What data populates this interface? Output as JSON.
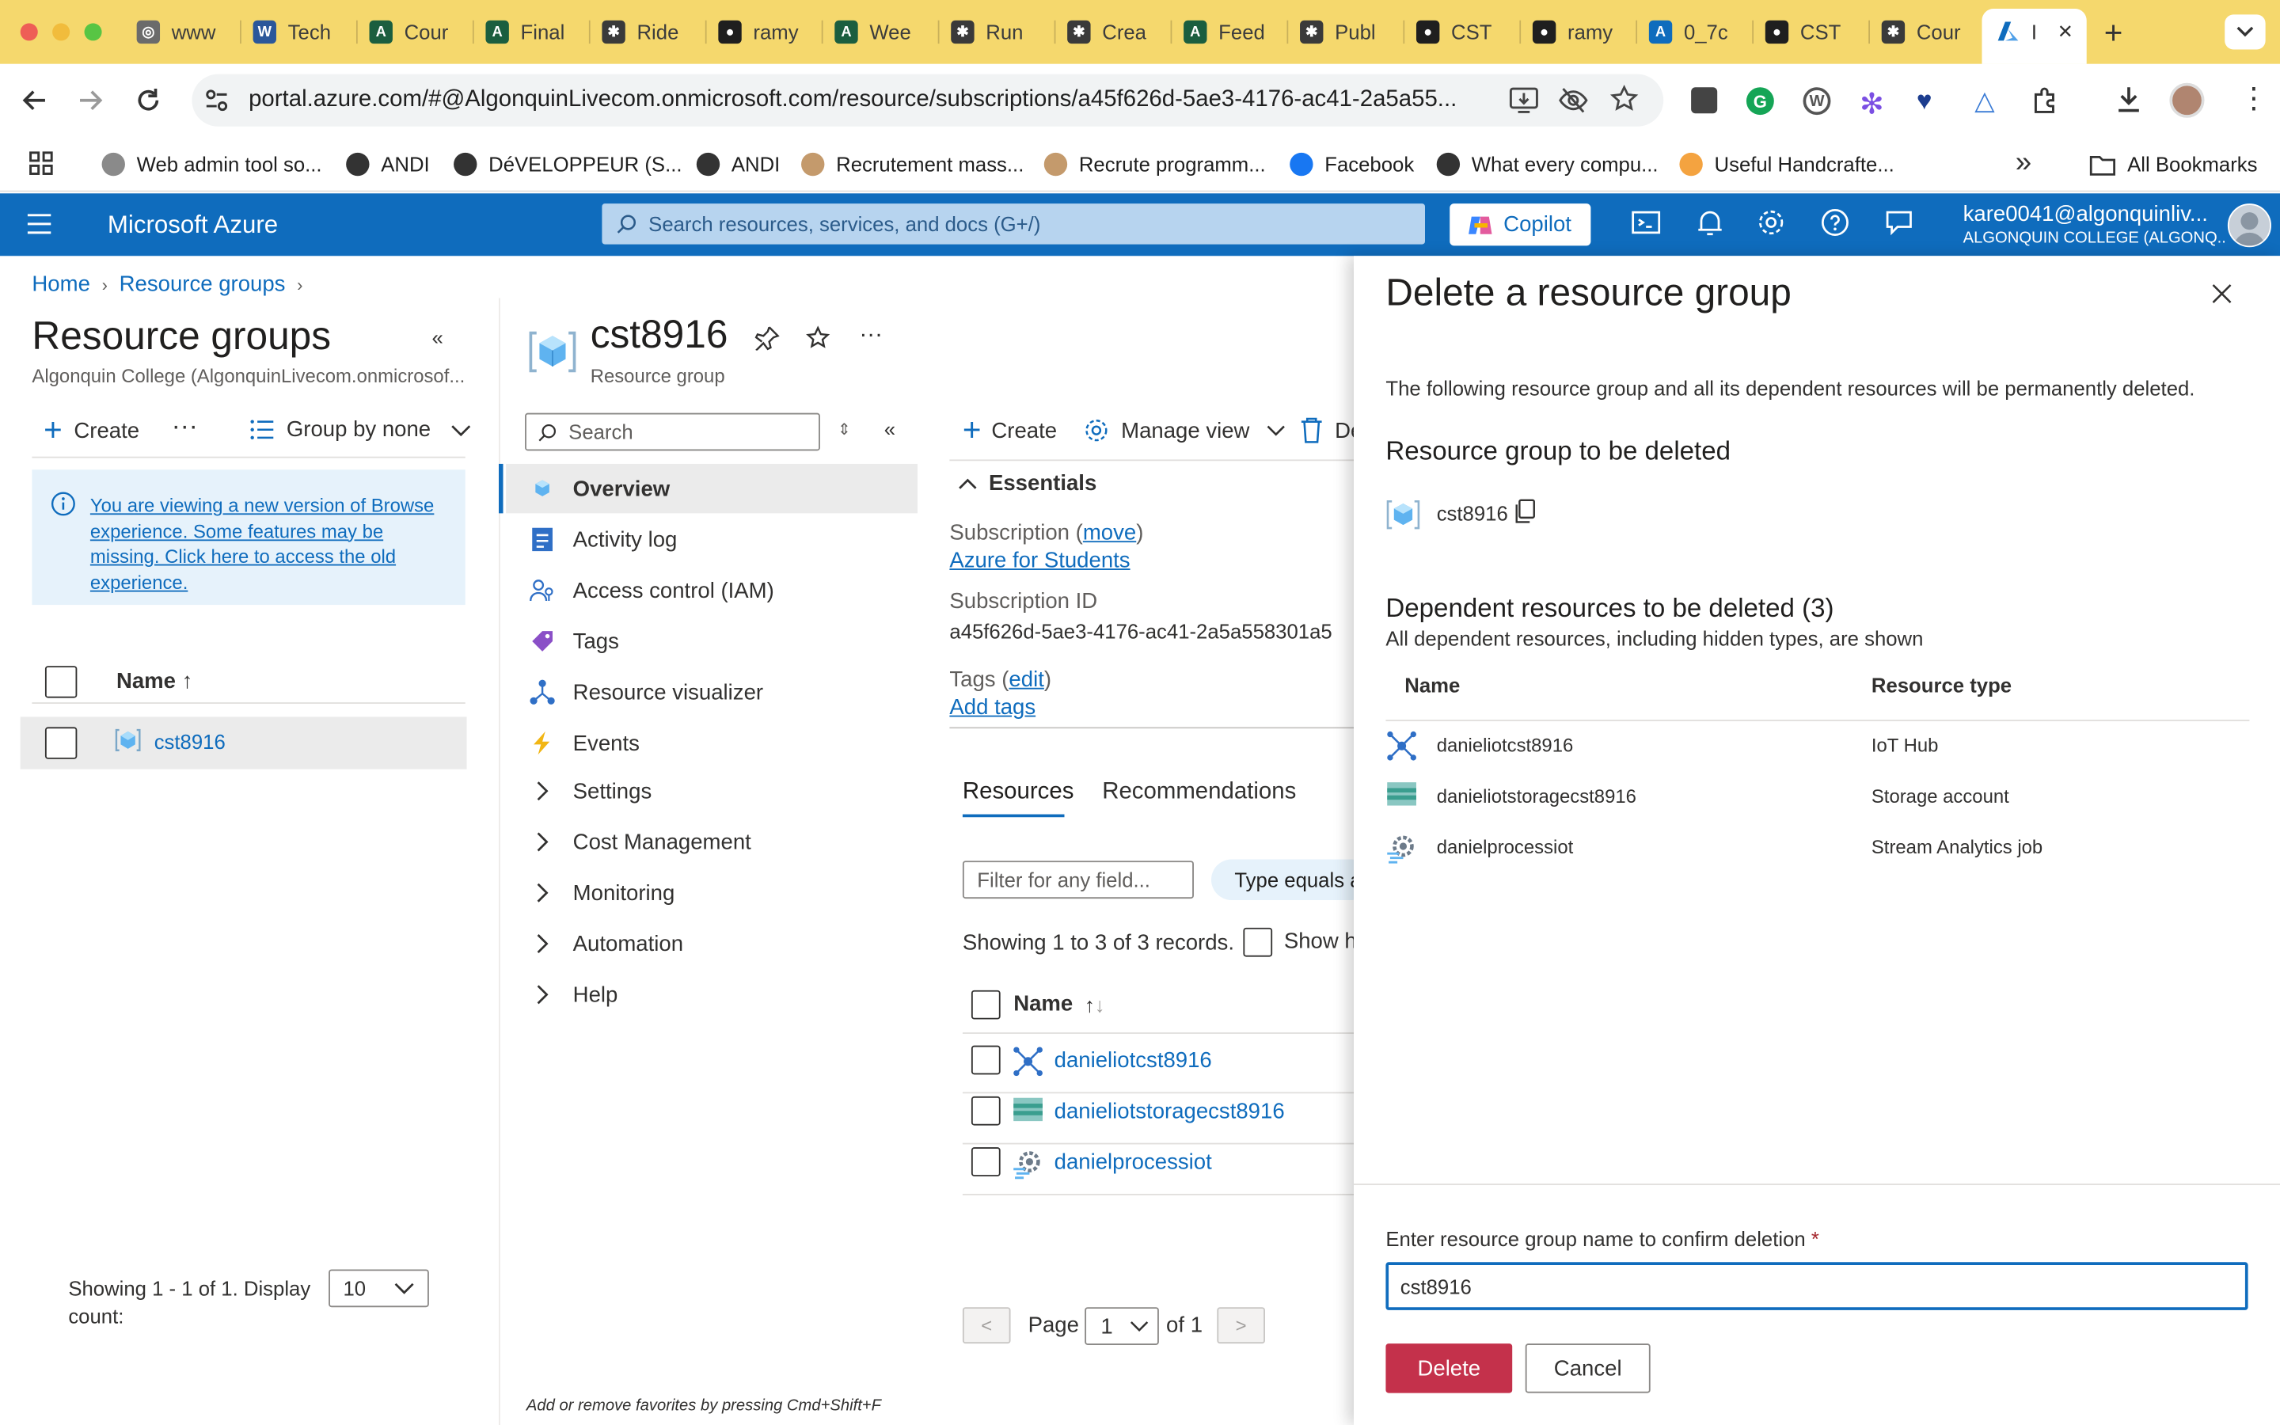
{
  "browser": {
    "tabs": [
      {
        "label": "www",
        "icon": "globe-icon"
      },
      {
        "label": "Tech",
        "icon": "word-icon"
      },
      {
        "label": "Cour",
        "icon": "brightspace-icon"
      },
      {
        "label": "Final",
        "icon": "brightspace-icon"
      },
      {
        "label": "Ride",
        "icon": "chatgpt-icon"
      },
      {
        "label": "ramy",
        "icon": "github-icon"
      },
      {
        "label": "Wee",
        "icon": "brightspace-icon"
      },
      {
        "label": "Run",
        "icon": "chatgpt-icon"
      },
      {
        "label": "Crea",
        "icon": "chatgpt-icon"
      },
      {
        "label": "Feed",
        "icon": "brightspace-icon"
      },
      {
        "label": "Publ",
        "icon": "chatgpt-icon"
      },
      {
        "label": "CST",
        "icon": "github-icon"
      },
      {
        "label": "ramy",
        "icon": "github-icon"
      },
      {
        "label": "0_7c",
        "icon": "azure-icon"
      },
      {
        "label": "CST",
        "icon": "github-icon"
      },
      {
        "label": "Cour",
        "icon": "chatgpt-icon"
      }
    ],
    "active_tab_label": "I",
    "url": "portal.azure.com/#@AlgonquinLivecom.onmicrosoft.com/resource/subscriptions/a45f626d-5ae3-4176-ac41-2a5a55...",
    "bookmarks": [
      {
        "label": "Web admin tool so...",
        "color": "#8a8a8a"
      },
      {
        "label": "ANDI",
        "color": "#333333"
      },
      {
        "label": "DéVELOPPEUR (S...",
        "color": "#333333"
      },
      {
        "label": "ANDI",
        "color": "#333333"
      },
      {
        "label": "Recrutement mass...",
        "color": "#c49a6c"
      },
      {
        "label": "Recrute programm...",
        "color": "#c49a6c"
      },
      {
        "label": "Facebook",
        "color": "#1877f2"
      },
      {
        "label": "What every compu...",
        "color": "#333333"
      },
      {
        "label": "Useful Handcrafte...",
        "color": "#f4a340"
      }
    ],
    "all_bookmarks": "All Bookmarks",
    "overflow": "»"
  },
  "azure": {
    "brand": "Microsoft Azure",
    "search_placeholder": "Search resources, services, and docs (G+/)",
    "copilot": "Copilot",
    "user_email": "kare0041@algonquinliv...",
    "user_org": "ALGONQUIN COLLEGE (ALGONQ..."
  },
  "breadcrumb": {
    "home": "Home",
    "rg": "Resource groups"
  },
  "left": {
    "title": "Resource groups",
    "subtitle": "Algonquin College (AlgonquinLivecom.onmicrosof...",
    "create": "Create",
    "more": "···",
    "group_by": "Group by none",
    "info_text": "You are viewing a new version of Browse experience. Some features may be missing. Click here to access the old experience.",
    "col_name": "Name ↑",
    "rows": [
      "cst8916"
    ],
    "showing": "Showing 1 - 1 of 1. Display count:",
    "display_count": "10"
  },
  "middle": {
    "title": "cst8916",
    "subtitle": "Resource group",
    "search_placeholder": "Search",
    "menu": [
      {
        "label": "Overview",
        "icon": "overview-icon",
        "selected": true
      },
      {
        "label": "Activity log",
        "icon": "activity-log-icon"
      },
      {
        "label": "Access control (IAM)",
        "icon": "iam-icon"
      },
      {
        "label": "Tags",
        "icon": "tag-icon"
      },
      {
        "label": "Resource visualizer",
        "icon": "visualizer-icon"
      },
      {
        "label": "Events",
        "icon": "events-icon"
      },
      {
        "label": "Settings",
        "icon": "chevron-right-icon"
      },
      {
        "label": "Cost Management",
        "icon": "chevron-right-icon"
      },
      {
        "label": "Monitoring",
        "icon": "chevron-right-icon"
      },
      {
        "label": "Automation",
        "icon": "chevron-right-icon"
      },
      {
        "label": "Help",
        "icon": "chevron-right-icon"
      }
    ],
    "toolbar": {
      "create": "Create",
      "manage_view": "Manage view",
      "delete_partial": "De"
    },
    "essentials": "Essentials",
    "subscription_label": "Subscription",
    "subscription_move": "move",
    "subscription_value": "Azure for Students",
    "subscription_id_label": "Subscription ID",
    "subscription_id": "a45f626d-5ae3-4176-ac41-2a5a558301a5",
    "tags_label": "Tags",
    "tags_edit": "edit",
    "add_tags": "Add tags",
    "tabs": [
      "Resources",
      "Recommendations"
    ],
    "filter_placeholder": "Filter for any field...",
    "type_filter": "Type equals a",
    "showing": "Showing 1 to 3 of 3 records.",
    "show_hidden": "Show hi",
    "col_name": "Name",
    "resources": [
      "danieliotcst8916",
      "danieliotstoragecst8916",
      "danielprocessiot"
    ],
    "page_label": "Page",
    "page_value": "1",
    "page_of": "of 1",
    "footer_hint": "Add or remove favorites by pressing Cmd+Shift+F"
  },
  "delete_panel": {
    "title": "Delete a resource group",
    "description": "The following resource group and all its dependent resources will be permanently deleted.",
    "section_title": "Resource group to be deleted",
    "rg_name": "cst8916",
    "dependent_title": "Dependent resources to be deleted (3)",
    "dependent_subtitle": "All dependent resources, including hidden types, are shown",
    "col_name": "Name",
    "col_type": "Resource type",
    "resources": [
      {
        "name": "danieliotcst8916",
        "type": "IoT Hub",
        "icon": "iot-hub-icon"
      },
      {
        "name": "danieliotstoragecst8916",
        "type": "Storage account",
        "icon": "storage-account-icon"
      },
      {
        "name": "danielprocessiot",
        "type": "Stream Analytics job",
        "icon": "stream-analytics-icon"
      }
    ],
    "confirm_label": "Enter resource group name to confirm deletion",
    "required_mark": "*",
    "confirm_value": "cst8916",
    "delete_button": "Delete",
    "cancel_button": "Cancel"
  },
  "colors": {
    "azure_blue": "#0f6cbd",
    "delete_red": "#c4314b",
    "tab_strip": "#f5d86d"
  }
}
